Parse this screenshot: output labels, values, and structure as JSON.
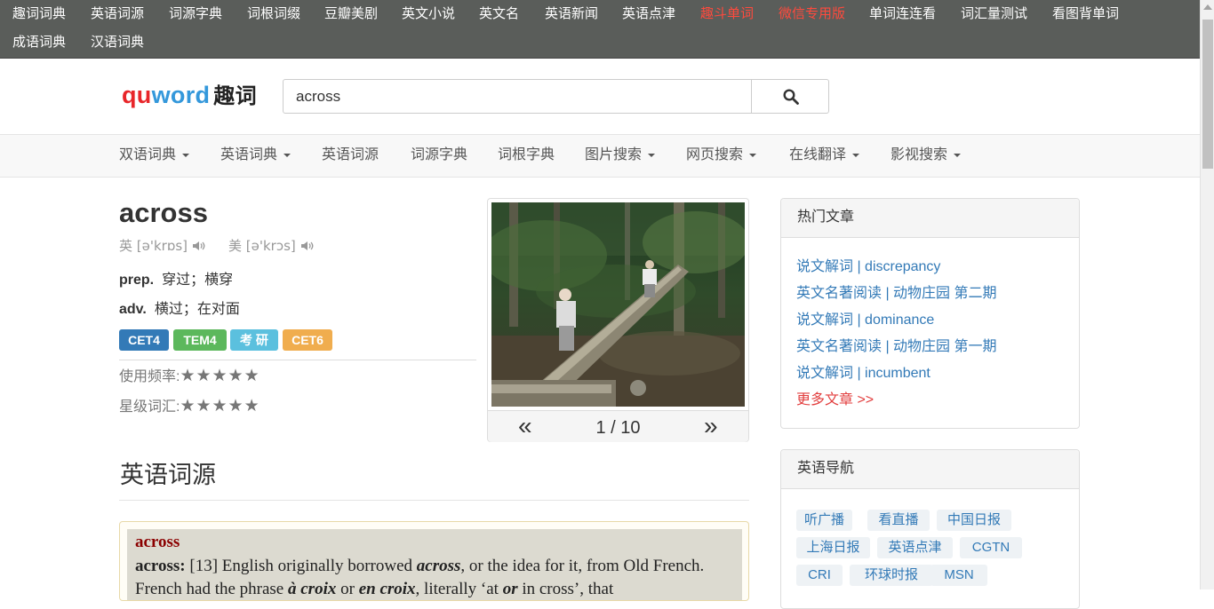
{
  "top_links": [
    {
      "label": "趣词词典",
      "highlight": false
    },
    {
      "label": "英语词源",
      "highlight": false
    },
    {
      "label": "词源字典",
      "highlight": false
    },
    {
      "label": "词根词缀",
      "highlight": false
    },
    {
      "label": "豆瓣美剧",
      "highlight": false
    },
    {
      "label": "英文小说",
      "highlight": false
    },
    {
      "label": "英文名",
      "highlight": false
    },
    {
      "label": "英语新闻",
      "highlight": false
    },
    {
      "label": "英语点津",
      "highlight": false
    },
    {
      "label": "趣斗单词",
      "highlight": true
    },
    {
      "label": "微信专用版",
      "highlight": true
    },
    {
      "label": "单词连连看",
      "highlight": false
    },
    {
      "label": "词汇量测试",
      "highlight": false
    },
    {
      "label": "看图背单词",
      "highlight": false
    },
    {
      "label": "成语词典",
      "highlight": false
    },
    {
      "label": "汉语词典",
      "highlight": false
    }
  ],
  "logo": {
    "part1": "qu",
    "part2": "word",
    "cn": "趣词"
  },
  "search": {
    "value": "across",
    "icon": "search-icon"
  },
  "nav": [
    {
      "label": "双语词典",
      "dropdown": true
    },
    {
      "label": "英语词典",
      "dropdown": true
    },
    {
      "label": "英语词源",
      "dropdown": false
    },
    {
      "label": "词源字典",
      "dropdown": false
    },
    {
      "label": "词根字典",
      "dropdown": false
    },
    {
      "label": "图片搜索",
      "dropdown": true
    },
    {
      "label": "网页搜索",
      "dropdown": true
    },
    {
      "label": "在线翻译",
      "dropdown": true
    },
    {
      "label": "影视搜索",
      "dropdown": true
    }
  ],
  "entry": {
    "word": "across",
    "phonetic_uk": "英 [ə'krɒs]",
    "phonetic_us": "美 [ə'krɔs]",
    "definitions": [
      {
        "pos": "prep.",
        "meaning": "穿过；横穿"
      },
      {
        "pos": "adv.",
        "meaning": "横过；在对面"
      }
    ],
    "tags": [
      {
        "label": "CET4",
        "color": "#337ab7"
      },
      {
        "label": "TEM4",
        "color": "#5cb85c"
      },
      {
        "label": "考 研",
        "color": "#5bc0de"
      },
      {
        "label": "CET6",
        "color": "#f0ad4e"
      }
    ],
    "frequency_label": "使用频率:",
    "frequency_stars": "★★★★★",
    "level_label": "星级词汇:",
    "level_stars": "★★★★★"
  },
  "image_viewer": {
    "prev": "«",
    "next": "»",
    "pager": "1 / 10"
  },
  "etymology": {
    "section_title": "英语词源",
    "head": "across",
    "text_html": "<b>across:</b> [13] English originally borrowed <b><i>across</i></b>, or the idea for it, from Old French. French had the phrase <b><i>à croix</i></b> or <b><i>en croix</i></b>, literally ‘at <b><i>or</i></b> in cross’, that"
  },
  "hot_articles": {
    "title": "热门文章",
    "items": [
      "说文解词 | discrepancy",
      "英文名著阅读 | 动物庄园 第二期",
      "说文解词 | dominance",
      "英文名著阅读 | 动物庄园 第一期",
      "说文解词 | incumbent"
    ],
    "more": "更多文章 >>"
  },
  "english_nav": {
    "title": "英语导航",
    "chips": [
      "听广播",
      "看直播",
      "中国日报",
      "上海日报",
      "英语点津",
      "CGTN",
      "CRI",
      "环球时报",
      "MSN"
    ]
  }
}
